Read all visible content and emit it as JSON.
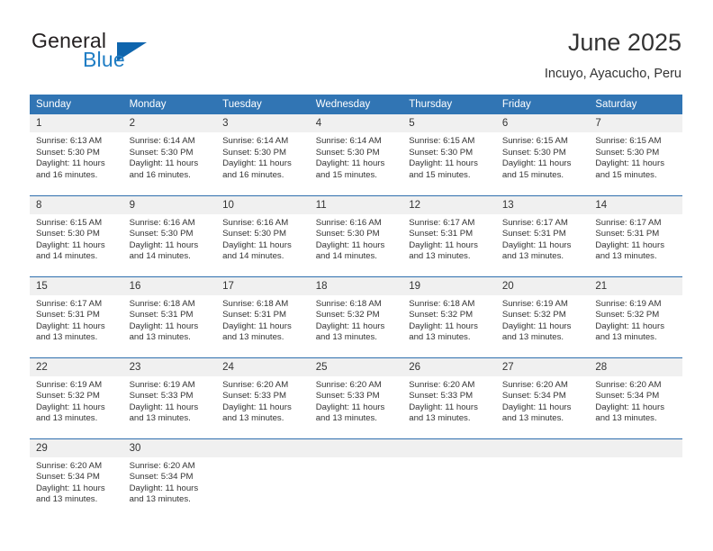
{
  "brand": {
    "name_part1": "General",
    "name_part2": "Blue",
    "logo_icon": "triangle-flag-icon",
    "accent_color": "#1f7dc4"
  },
  "header": {
    "title": "June 2025",
    "location": "Incuyo, Ayacucho, Peru"
  },
  "calendar": {
    "header_background": "#3175b4",
    "daynum_background": "#f0f0f0",
    "weekdays": [
      "Sunday",
      "Monday",
      "Tuesday",
      "Wednesday",
      "Thursday",
      "Friday",
      "Saturday"
    ],
    "weeks": [
      [
        {
          "day": "1",
          "sunrise": "Sunrise: 6:13 AM",
          "sunset": "Sunset: 5:30 PM",
          "daylight_line1": "Daylight: 11 hours",
          "daylight_line2": "and 16 minutes."
        },
        {
          "day": "2",
          "sunrise": "Sunrise: 6:14 AM",
          "sunset": "Sunset: 5:30 PM",
          "daylight_line1": "Daylight: 11 hours",
          "daylight_line2": "and 16 minutes."
        },
        {
          "day": "3",
          "sunrise": "Sunrise: 6:14 AM",
          "sunset": "Sunset: 5:30 PM",
          "daylight_line1": "Daylight: 11 hours",
          "daylight_line2": "and 16 minutes."
        },
        {
          "day": "4",
          "sunrise": "Sunrise: 6:14 AM",
          "sunset": "Sunset: 5:30 PM",
          "daylight_line1": "Daylight: 11 hours",
          "daylight_line2": "and 15 minutes."
        },
        {
          "day": "5",
          "sunrise": "Sunrise: 6:15 AM",
          "sunset": "Sunset: 5:30 PM",
          "daylight_line1": "Daylight: 11 hours",
          "daylight_line2": "and 15 minutes."
        },
        {
          "day": "6",
          "sunrise": "Sunrise: 6:15 AM",
          "sunset": "Sunset: 5:30 PM",
          "daylight_line1": "Daylight: 11 hours",
          "daylight_line2": "and 15 minutes."
        },
        {
          "day": "7",
          "sunrise": "Sunrise: 6:15 AM",
          "sunset": "Sunset: 5:30 PM",
          "daylight_line1": "Daylight: 11 hours",
          "daylight_line2": "and 15 minutes."
        }
      ],
      [
        {
          "day": "8",
          "sunrise": "Sunrise: 6:15 AM",
          "sunset": "Sunset: 5:30 PM",
          "daylight_line1": "Daylight: 11 hours",
          "daylight_line2": "and 14 minutes."
        },
        {
          "day": "9",
          "sunrise": "Sunrise: 6:16 AM",
          "sunset": "Sunset: 5:30 PM",
          "daylight_line1": "Daylight: 11 hours",
          "daylight_line2": "and 14 minutes."
        },
        {
          "day": "10",
          "sunrise": "Sunrise: 6:16 AM",
          "sunset": "Sunset: 5:30 PM",
          "daylight_line1": "Daylight: 11 hours",
          "daylight_line2": "and 14 minutes."
        },
        {
          "day": "11",
          "sunrise": "Sunrise: 6:16 AM",
          "sunset": "Sunset: 5:30 PM",
          "daylight_line1": "Daylight: 11 hours",
          "daylight_line2": "and 14 minutes."
        },
        {
          "day": "12",
          "sunrise": "Sunrise: 6:17 AM",
          "sunset": "Sunset: 5:31 PM",
          "daylight_line1": "Daylight: 11 hours",
          "daylight_line2": "and 13 minutes."
        },
        {
          "day": "13",
          "sunrise": "Sunrise: 6:17 AM",
          "sunset": "Sunset: 5:31 PM",
          "daylight_line1": "Daylight: 11 hours",
          "daylight_line2": "and 13 minutes."
        },
        {
          "day": "14",
          "sunrise": "Sunrise: 6:17 AM",
          "sunset": "Sunset: 5:31 PM",
          "daylight_line1": "Daylight: 11 hours",
          "daylight_line2": "and 13 minutes."
        }
      ],
      [
        {
          "day": "15",
          "sunrise": "Sunrise: 6:17 AM",
          "sunset": "Sunset: 5:31 PM",
          "daylight_line1": "Daylight: 11 hours",
          "daylight_line2": "and 13 minutes."
        },
        {
          "day": "16",
          "sunrise": "Sunrise: 6:18 AM",
          "sunset": "Sunset: 5:31 PM",
          "daylight_line1": "Daylight: 11 hours",
          "daylight_line2": "and 13 minutes."
        },
        {
          "day": "17",
          "sunrise": "Sunrise: 6:18 AM",
          "sunset": "Sunset: 5:31 PM",
          "daylight_line1": "Daylight: 11 hours",
          "daylight_line2": "and 13 minutes."
        },
        {
          "day": "18",
          "sunrise": "Sunrise: 6:18 AM",
          "sunset": "Sunset: 5:32 PM",
          "daylight_line1": "Daylight: 11 hours",
          "daylight_line2": "and 13 minutes."
        },
        {
          "day": "19",
          "sunrise": "Sunrise: 6:18 AM",
          "sunset": "Sunset: 5:32 PM",
          "daylight_line1": "Daylight: 11 hours",
          "daylight_line2": "and 13 minutes."
        },
        {
          "day": "20",
          "sunrise": "Sunrise: 6:19 AM",
          "sunset": "Sunset: 5:32 PM",
          "daylight_line1": "Daylight: 11 hours",
          "daylight_line2": "and 13 minutes."
        },
        {
          "day": "21",
          "sunrise": "Sunrise: 6:19 AM",
          "sunset": "Sunset: 5:32 PM",
          "daylight_line1": "Daylight: 11 hours",
          "daylight_line2": "and 13 minutes."
        }
      ],
      [
        {
          "day": "22",
          "sunrise": "Sunrise: 6:19 AM",
          "sunset": "Sunset: 5:32 PM",
          "daylight_line1": "Daylight: 11 hours",
          "daylight_line2": "and 13 minutes."
        },
        {
          "day": "23",
          "sunrise": "Sunrise: 6:19 AM",
          "sunset": "Sunset: 5:33 PM",
          "daylight_line1": "Daylight: 11 hours",
          "daylight_line2": "and 13 minutes."
        },
        {
          "day": "24",
          "sunrise": "Sunrise: 6:20 AM",
          "sunset": "Sunset: 5:33 PM",
          "daylight_line1": "Daylight: 11 hours",
          "daylight_line2": "and 13 minutes."
        },
        {
          "day": "25",
          "sunrise": "Sunrise: 6:20 AM",
          "sunset": "Sunset: 5:33 PM",
          "daylight_line1": "Daylight: 11 hours",
          "daylight_line2": "and 13 minutes."
        },
        {
          "day": "26",
          "sunrise": "Sunrise: 6:20 AM",
          "sunset": "Sunset: 5:33 PM",
          "daylight_line1": "Daylight: 11 hours",
          "daylight_line2": "and 13 minutes."
        },
        {
          "day": "27",
          "sunrise": "Sunrise: 6:20 AM",
          "sunset": "Sunset: 5:34 PM",
          "daylight_line1": "Daylight: 11 hours",
          "daylight_line2": "and 13 minutes."
        },
        {
          "day": "28",
          "sunrise": "Sunrise: 6:20 AM",
          "sunset": "Sunset: 5:34 PM",
          "daylight_line1": "Daylight: 11 hours",
          "daylight_line2": "and 13 minutes."
        }
      ],
      [
        {
          "day": "29",
          "sunrise": "Sunrise: 6:20 AM",
          "sunset": "Sunset: 5:34 PM",
          "daylight_line1": "Daylight: 11 hours",
          "daylight_line2": "and 13 minutes."
        },
        {
          "day": "30",
          "sunrise": "Sunrise: 6:20 AM",
          "sunset": "Sunset: 5:34 PM",
          "daylight_line1": "Daylight: 11 hours",
          "daylight_line2": "and 13 minutes."
        },
        {
          "day": "",
          "sunrise": "",
          "sunset": "",
          "daylight_line1": "",
          "daylight_line2": ""
        },
        {
          "day": "",
          "sunrise": "",
          "sunset": "",
          "daylight_line1": "",
          "daylight_line2": ""
        },
        {
          "day": "",
          "sunrise": "",
          "sunset": "",
          "daylight_line1": "",
          "daylight_line2": ""
        },
        {
          "day": "",
          "sunrise": "",
          "sunset": "",
          "daylight_line1": "",
          "daylight_line2": ""
        },
        {
          "day": "",
          "sunrise": "",
          "sunset": "",
          "daylight_line1": "",
          "daylight_line2": ""
        }
      ]
    ]
  }
}
